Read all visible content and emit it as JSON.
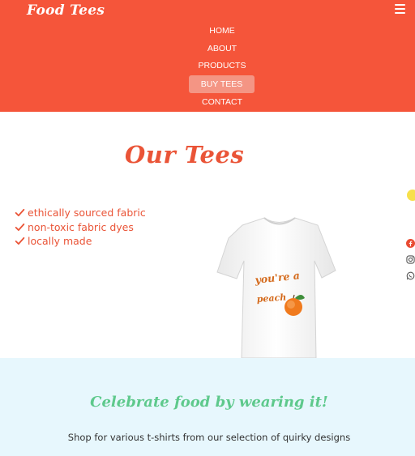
{
  "nav": {
    "brand": "Food Tees",
    "menu_icon": "hamburger-icon",
    "items": [
      {
        "label": "HOME",
        "active": false
      },
      {
        "label": "ABOUT",
        "active": false
      },
      {
        "label": "PRODUCTS",
        "active": false
      },
      {
        "label": "BUY TEES",
        "active": true
      },
      {
        "label": "CONTACT",
        "active": false
      }
    ]
  },
  "hero": {
    "title": "Our Tees",
    "features": [
      "ethically sourced fabric",
      "non-toxic fabric dyes",
      "locally made"
    ],
    "feature_icon": "check-icon",
    "tshirt_print_line1": "you're a",
    "tshirt_print_line2": "peach"
  },
  "side_icons": [
    "chat-icon",
    "facebook-icon",
    "instagram-icon",
    "whatsapp-icon"
  ],
  "footer_banner": {
    "tagline": "Celebrate food by wearing it!",
    "subline": "Shop for various t-shirts from our selection of quirky designs"
  },
  "colors": {
    "nav_bg": "#f5553a",
    "accent": "#ea5437",
    "active_item_bg": "#f49584",
    "banner_bg": "#e7f7fd",
    "tagline": "#5ec98c"
  }
}
